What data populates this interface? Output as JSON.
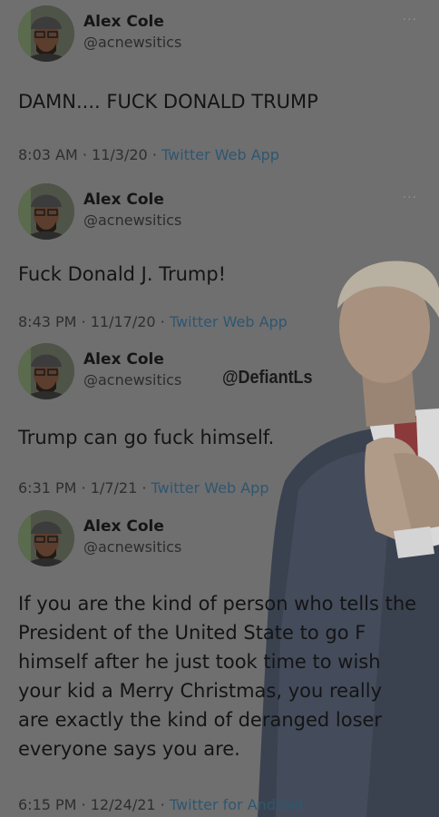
{
  "tweets": [
    {
      "name": "Alex Cole",
      "handle": "@acnewsitics",
      "text": "DAMN.... FUCK DONALD TRUMP",
      "time": "8:03 AM",
      "date": "11/3/20",
      "app": "Twitter Web App",
      "separator": "·",
      "more": "···"
    },
    {
      "name": "Alex Cole",
      "handle": "@acnewsitics",
      "text": "Fuck Donald J. Trump!",
      "time": "8:43 PM",
      "date": "11/17/20",
      "app": "Twitter Web App",
      "separator": "·",
      "more": "···"
    },
    {
      "name": "Alex Cole",
      "handle": "@acnewsitics",
      "text": "Trump can go fuck himself.",
      "time": "6:31 PM",
      "date": "1/7/21",
      "app": "Twitter Web App",
      "separator": "·"
    },
    {
      "name": "Alex Cole",
      "handle": "@acnewsitics",
      "text": "If you are the kind of person who tells the President of the United State to go F himself after he just took time to wish your kid a Merry Christmas, you really are exactly the kind of deranged loser everyone says you are.",
      "time": "6:15 PM",
      "date": "12/24/21",
      "app": "Twitter for Android",
      "separator": "·"
    }
  ],
  "watermark": "@DefiantLs",
  "colors": {
    "background": "#6f6f6f",
    "link": "#2f5670",
    "text": "#141414",
    "secondary": "#2e2e2e"
  }
}
